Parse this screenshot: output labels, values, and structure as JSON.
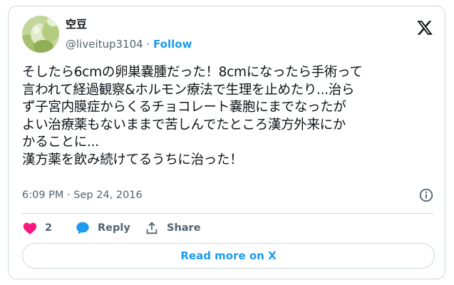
{
  "author": {
    "display_name": "空豆",
    "handle": "@liveitup3104",
    "separator": "·",
    "follow_label": "Follow"
  },
  "tweet": {
    "lines": [
      "そしたら6cmの卵巣嚢腫だった！8cmになったら手術って",
      "言われて経過観察&ホルモン療法で生理を止めたり...治ら",
      "ず子宮内膜症からくるチョコレート嚢胞にまでなったが",
      "よい治療薬もないままで苦しんでたところ漢方外来にか",
      "かることに...",
      "漢方薬を飲み続けてるうちに治った！"
    ],
    "timestamp": "6:09 PM · Sep 24, 2016"
  },
  "actions": {
    "like_count": "2",
    "reply_label": "Reply",
    "share_label": "Share",
    "read_more_label": "Read more on X"
  },
  "icons": {
    "logo": "x-logo-icon",
    "info": "info-icon",
    "like": "heart-icon",
    "reply": "speech-bubble-icon",
    "share": "share-upload-icon"
  },
  "colors": {
    "accent": "#1d9bf0",
    "like": "#f91880",
    "text": "#0f1419",
    "secondary": "#536471",
    "border": "#cfd9de"
  }
}
